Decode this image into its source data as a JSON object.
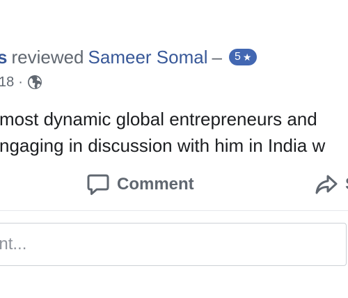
{
  "review": {
    "author_fragment": "s",
    "verb": "reviewed",
    "page_name": "Sameer Somal",
    "dash": "–",
    "rating_value": "5",
    "rating_star": "★"
  },
  "meta": {
    "date_fragment": "18",
    "separator": "·",
    "privacy_icon": "globe-icon"
  },
  "post": {
    "lines": [
      "most dynamic global entrepreneurs and",
      "ngaging in discussion with him in India w"
    ]
  },
  "actions": {
    "comment_label": "Comment",
    "comment_icon": "speech-bubble-icon",
    "share_label": "S",
    "share_icon": "share-arrow-icon"
  },
  "comment_box": {
    "placeholder_fragment": "ent..."
  },
  "colors": {
    "link": "#385898",
    "muted": "#606770",
    "badge": "#4267b2",
    "text": "#1c1e21"
  }
}
